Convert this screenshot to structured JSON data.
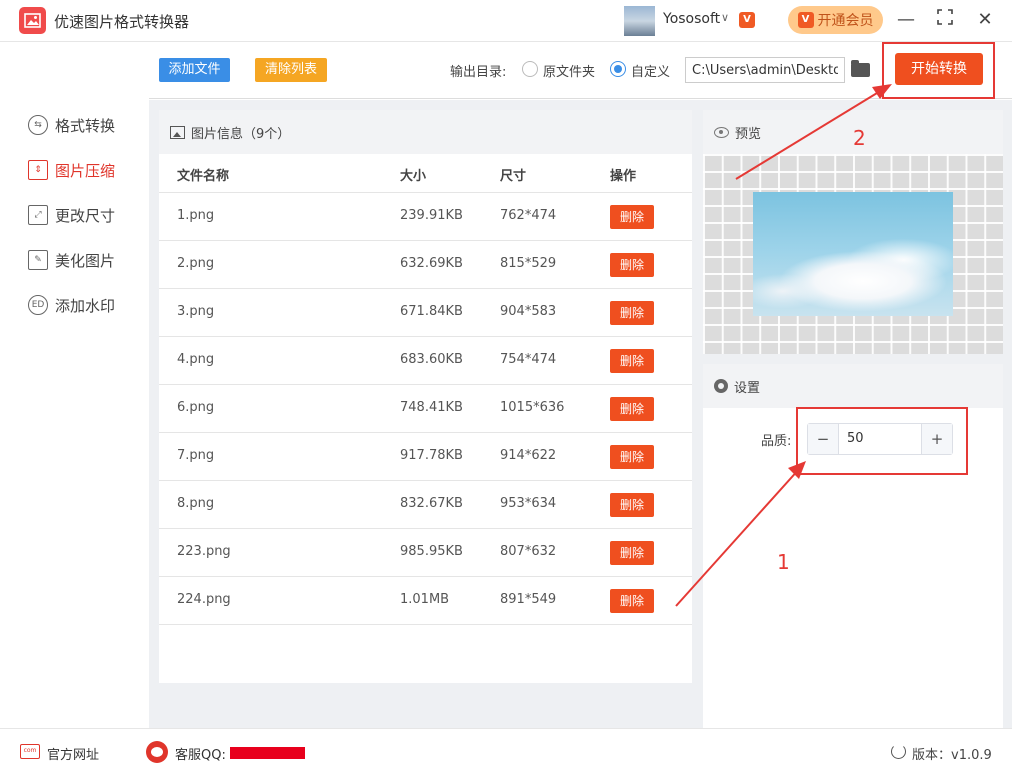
{
  "app": {
    "title": "优速图片格式转换器",
    "username": "Yososoft",
    "vip_button": "开通会员",
    "vip_badge": "V"
  },
  "sidebar": {
    "items": [
      {
        "label": "格式转换",
        "icon": "format-convert-icon"
      },
      {
        "label": "图片压缩",
        "icon": "compress-icon",
        "active": true
      },
      {
        "label": "更改尺寸",
        "icon": "resize-icon"
      },
      {
        "label": "美化图片",
        "icon": "beautify-icon"
      },
      {
        "label": "添加水印",
        "icon": "watermark-icon"
      }
    ]
  },
  "toolbar": {
    "add_file": "添加文件",
    "clear_list": "清除列表",
    "output_label": "输出目录:",
    "option_original": "原文件夹",
    "option_custom": "自定义",
    "path_value": "C:\\Users\\admin\\Desktop",
    "start": "开始转换"
  },
  "file_panel": {
    "title": "图片信息（9个）",
    "columns": [
      "文件名称",
      "大小",
      "尺寸",
      "操作"
    ],
    "delete_label": "删除",
    "rows": [
      {
        "name": "1.png",
        "size": "239.91KB",
        "dim": "762*474"
      },
      {
        "name": "2.png",
        "size": "632.69KB",
        "dim": "815*529"
      },
      {
        "name": "3.png",
        "size": "671.84KB",
        "dim": "904*583"
      },
      {
        "name": "4.png",
        "size": "683.60KB",
        "dim": "754*474"
      },
      {
        "name": "6.png",
        "size": "748.41KB",
        "dim": "1015*636"
      },
      {
        "name": "7.png",
        "size": "917.78KB",
        "dim": "914*622"
      },
      {
        "name": "8.png",
        "size": "832.67KB",
        "dim": "953*634"
      },
      {
        "name": "223.png",
        "size": "985.95KB",
        "dim": "807*632"
      },
      {
        "name": "224.png",
        "size": "1.01MB",
        "dim": "891*549"
      }
    ]
  },
  "preview": {
    "title": "预览"
  },
  "settings": {
    "title": "设置",
    "quality_label": "品质:",
    "quality_value": "50",
    "minus": "−",
    "plus": "+"
  },
  "annotations": {
    "one": "1",
    "two": "2",
    "color": "#e53935"
  },
  "footer": {
    "website": "官方网址",
    "qq_label": "客服QQ:",
    "version": "版本：v1.0.9"
  },
  "colors": {
    "accent_red": "#ef4f1f",
    "blue": "#3a8ee6",
    "orange": "#f5a623"
  }
}
